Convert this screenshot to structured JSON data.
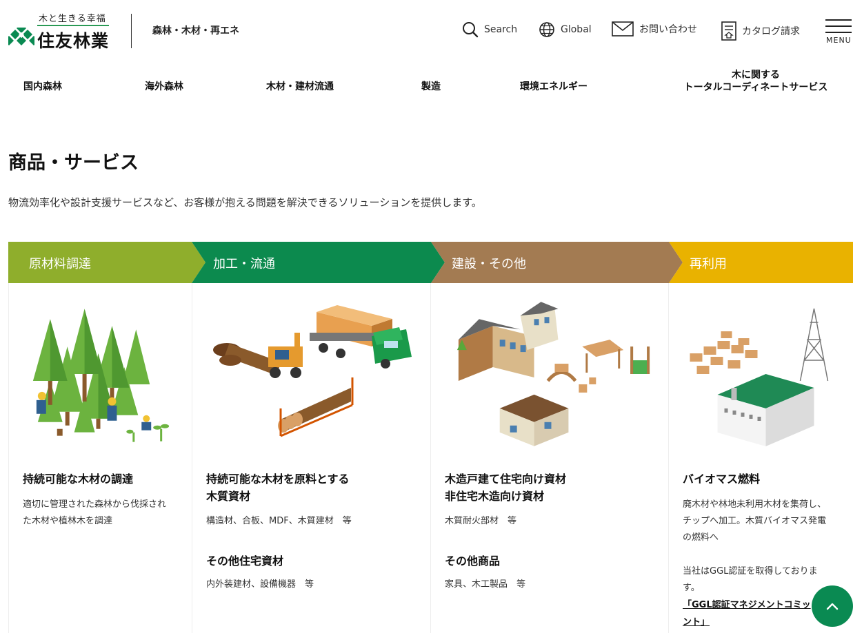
{
  "header": {
    "logo_tagline": "木と生きる幸福",
    "logo_name": "住友林業",
    "subtitle": "森林・木材・再エネ",
    "search_label": "Search",
    "global_label": "Global",
    "contact_label": "お問い合わせ",
    "catalog_label": "カタログ請求",
    "menu_label": "MENU"
  },
  "nav": {
    "items": [
      {
        "label": "国内森林"
      },
      {
        "label": "海外森林"
      },
      {
        "label": "木材・建材流通"
      },
      {
        "label": "製造"
      },
      {
        "label": "環境エネルギー"
      },
      {
        "label_line1": "木に関する",
        "label_line2": "トータルコーディネートサービス"
      }
    ]
  },
  "main": {
    "title": "商品・サービス",
    "lead": "物流効率化や設計支援サービスなど、お客様が抱える問題を解決できるソリューションを提供します。",
    "stages": [
      {
        "label": "原材料調達",
        "color": "#8fae2c"
      },
      {
        "label": "加工・流通",
        "color": "#0c8a4e"
      },
      {
        "label": "建設・その他",
        "color": "#a37b52"
      },
      {
        "label": "再利用",
        "color": "#e9b200"
      }
    ],
    "columns": [
      {
        "title": "持続可能な木材の調達",
        "text_line1": "適切に管理された森林から伐採され",
        "text_line2": "た木材や植林木を調達"
      },
      {
        "title_line1": "持続可能な木材を原料とする",
        "title_line2": "木質資材",
        "text": "構造材、合板、MDF、木質建材　等",
        "sub_title": "その他住宅資材",
        "sub_text": "内外装建材、設備機器　等"
      },
      {
        "title_line1": "木造戸建て住宅向け資材",
        "title_line2": "非住宅木造向け資材",
        "text": "木質耐火部材　等",
        "sub_title": "その他商品",
        "sub_text": "家具、木工製品　等"
      },
      {
        "title": "バイオマス燃料",
        "text_line1": "廃木材や林地未利用木材を集荷し、",
        "text_line2": "チップへ加工。木質バイオマス発電",
        "text_line3": "の燃料へ",
        "note_line1": "当社はGGL認証を取得しておりま",
        "note_line2": "す。",
        "link_line1": "「GGL認証マネジメントコミッ",
        "link_line2": "ント」"
      }
    ]
  },
  "icons": {
    "search": "search-icon",
    "global": "globe-icon",
    "contact": "mail-icon",
    "catalog": "catalog-icon",
    "menu": "hamburger-icon",
    "to_top": "chevron-up-icon"
  }
}
